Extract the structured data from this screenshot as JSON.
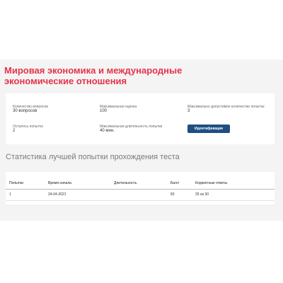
{
  "page": {
    "title": "Мировая экономика и международные экономические отношения"
  },
  "summary": {
    "fields": [
      {
        "label": "Количество вопросов",
        "value": "30 вопросов"
      },
      {
        "label": "Максимальная оценка",
        "value": "100"
      },
      {
        "label": "Максимально допустимое количество попыток",
        "value": "3"
      },
      {
        "label": "Осталось попыток",
        "value": "2"
      },
      {
        "label": "Максимальная длительность попытки",
        "value": "40 мин."
      }
    ],
    "button_label": "Идентификация"
  },
  "stats": {
    "title": "Статистика лучшей попытки прохождения теста",
    "columns": [
      "Попытки",
      "Время начала",
      "Длительность",
      "Балл",
      "Корректные ответы"
    ],
    "rows": [
      [
        "1",
        "24-04-2021",
        "",
        "83",
        "25 из 30"
      ]
    ]
  }
}
